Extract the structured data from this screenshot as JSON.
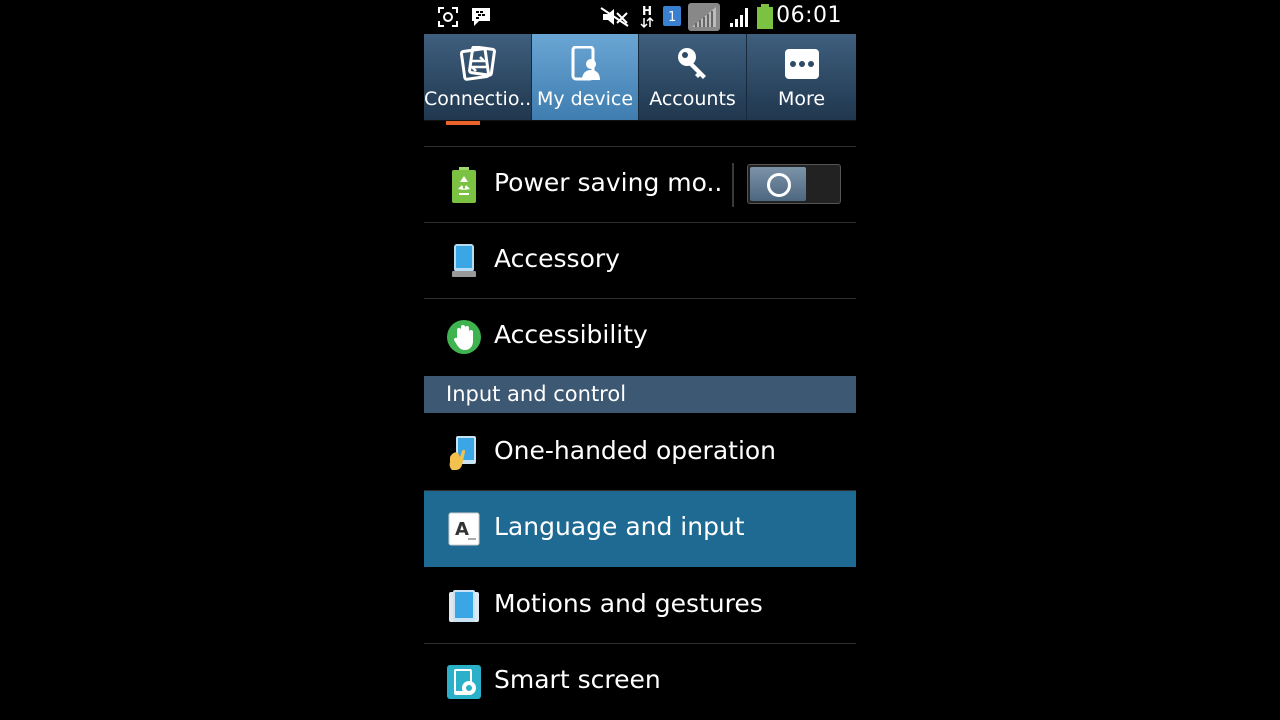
{
  "status_bar": {
    "time": "06:01",
    "left_icons": [
      "screenshot-icon",
      "bbm-icon"
    ],
    "right_icons": [
      "mute-icon",
      "h-signal-icon",
      "sim1-icon",
      "no-signal-icon",
      "signal-bars-icon",
      "battery-icon"
    ]
  },
  "tabs": [
    {
      "label": "Connectio..",
      "icon": "connections-icon",
      "active": false
    },
    {
      "label": "My device",
      "icon": "my-device-icon",
      "active": true
    },
    {
      "label": "Accounts",
      "icon": "key-icon",
      "active": false
    },
    {
      "label": "More",
      "icon": "more-dots-icon",
      "active": false
    }
  ],
  "list": {
    "power_saving": {
      "label": "Power saving mo..",
      "icon": "battery-recycle-icon",
      "toggle_on": false
    },
    "accessory": {
      "label": "Accessory",
      "icon": "phone-accessory-icon"
    },
    "accessibility": {
      "label": "Accessibility",
      "icon": "hand-icon"
    },
    "section_input": "Input and control",
    "one_handed": {
      "label": "One-handed operation",
      "icon": "one-hand-icon"
    },
    "language": {
      "label": "Language and input",
      "icon": "language-a-icon",
      "selected": true
    },
    "motions": {
      "label": "Motions and gestures",
      "icon": "motion-icon"
    },
    "smart_screen": {
      "label": "Smart screen",
      "icon": "smart-screen-icon"
    }
  },
  "colors": {
    "tab_bar": "#2d4a66",
    "tab_active": "#5592c4",
    "selected_row": "#1f6a92",
    "section_header": "#3d5873",
    "battery_green": "#7cc242"
  }
}
